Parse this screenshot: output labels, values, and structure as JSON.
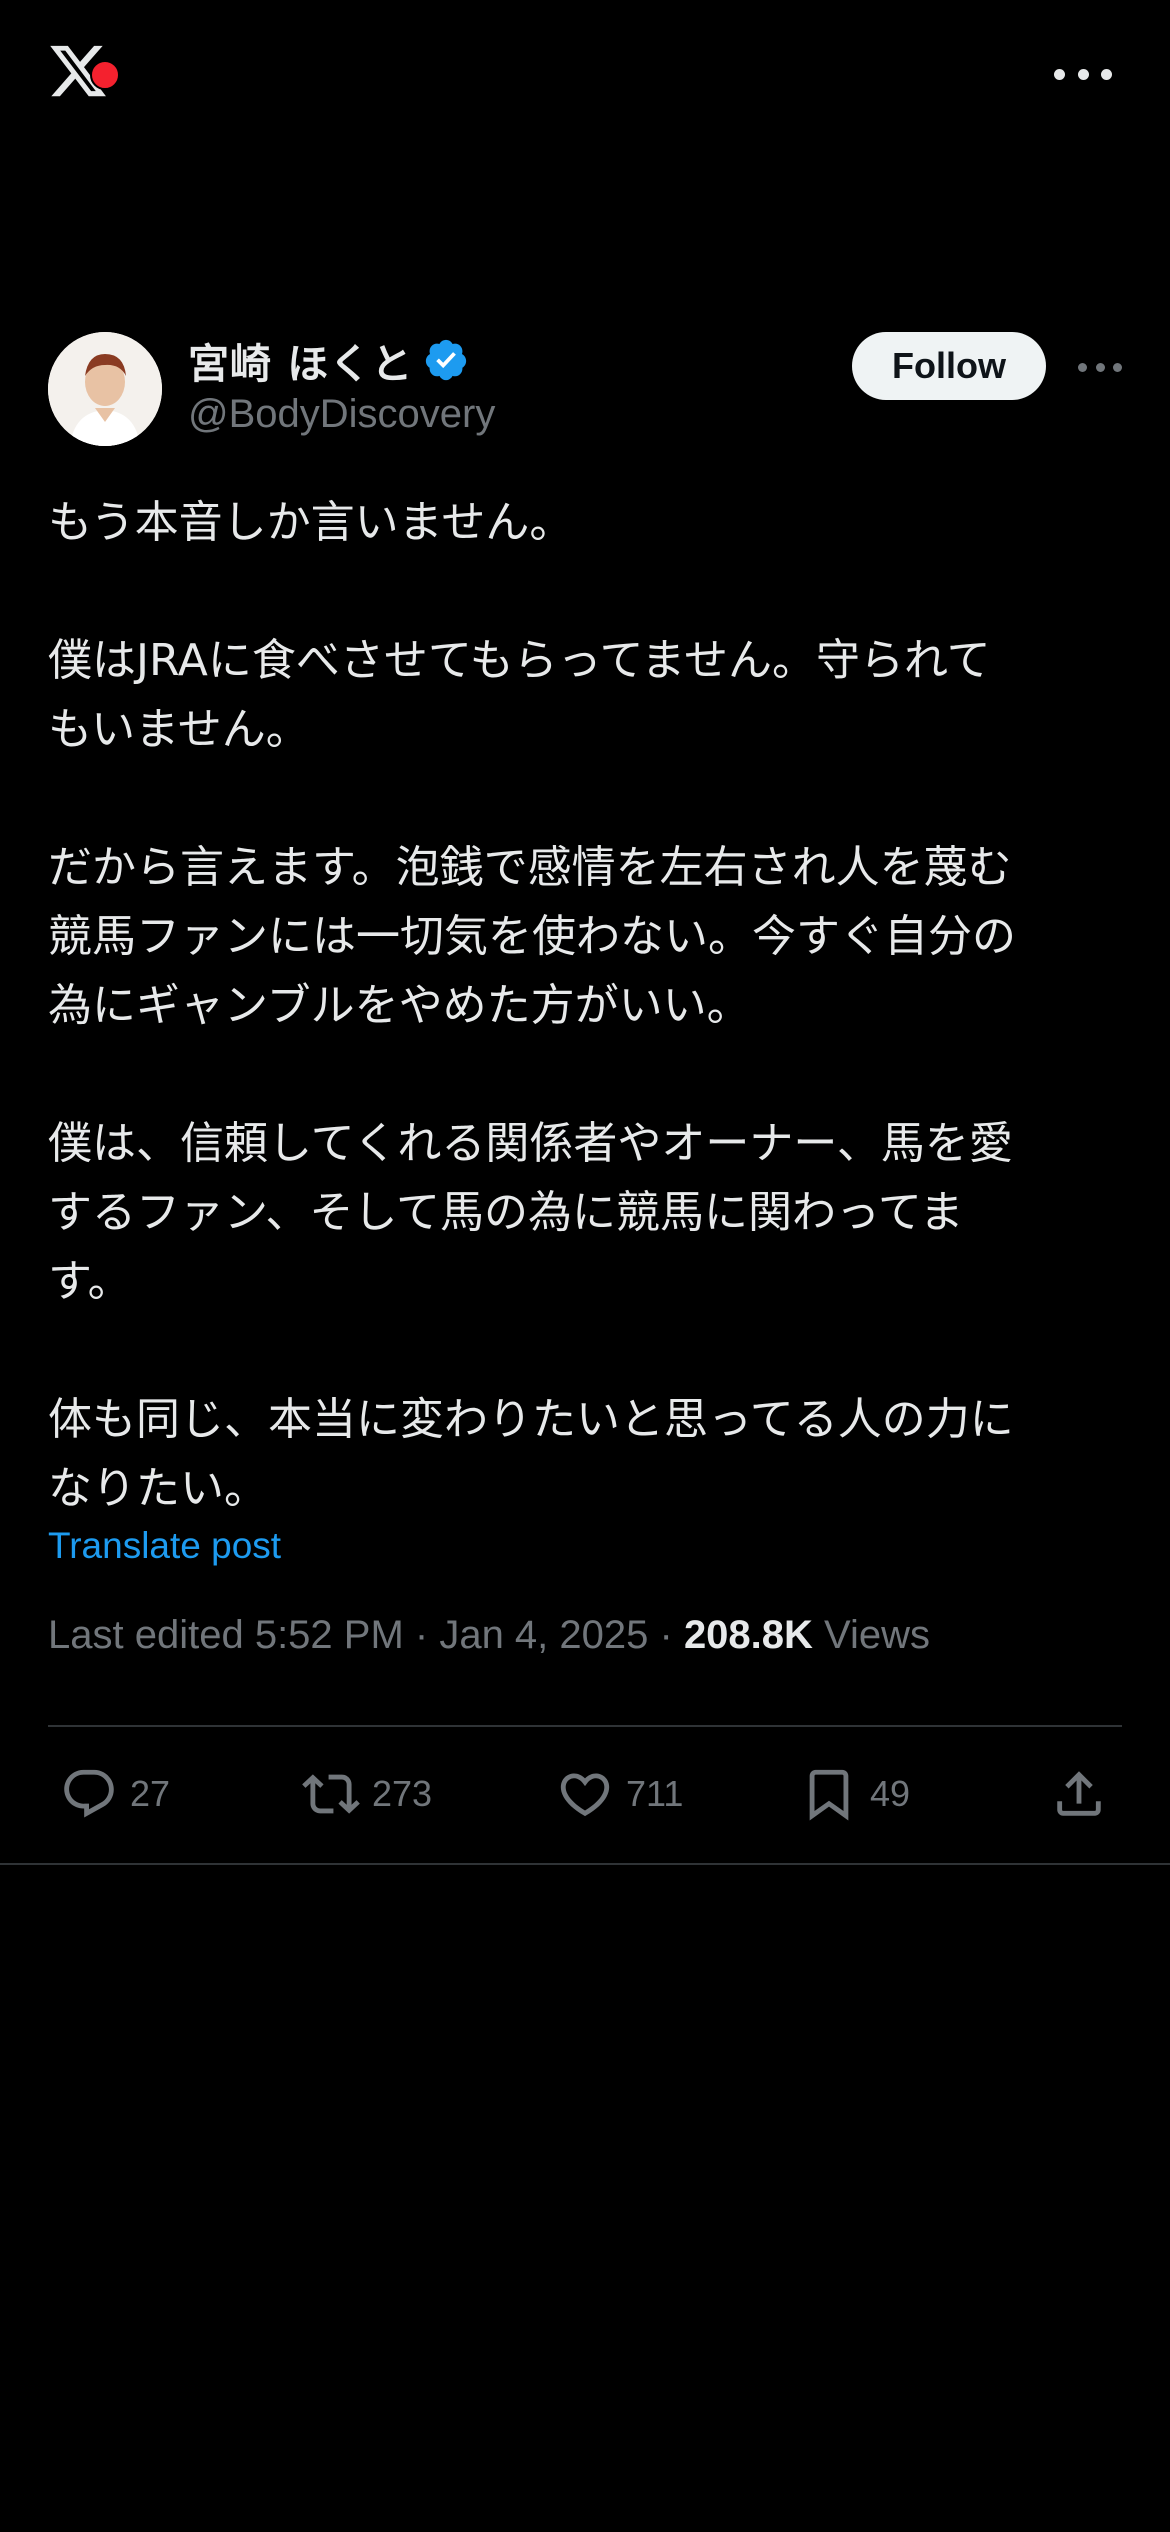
{
  "header": {
    "logo_icon": "x-logo-icon",
    "menu_icon": "more-horizontal-icon"
  },
  "author": {
    "display_name": "宮崎 ほくと",
    "handle": "@BodyDiscovery",
    "verified": true,
    "verified_color": "#1d9bf0"
  },
  "follow_label": "Follow",
  "tweet": {
    "paragraphs": [
      "もう本音しか言いません。",
      "僕はJRAに食べさせてもらってません。守られて\nもいません。",
      "だから言えます。泡銭で感情を左右され人を蔑む\n競馬ファンには一切気を使わない。今すぐ自分の\n為にギャンブルをやめた方がいい。",
      "僕は、信頼してくれる関係者やオーナー、馬を愛\nするファン、そして馬の為に競馬に関わってま\nす。",
      "体も同じ、本当に変わりたいと思ってる人の力に\nなりたい。"
    ],
    "translate_label": "Translate post"
  },
  "meta": {
    "edited_label": "Last edited 5:52 PM · Jan 4, 2025 · ",
    "views_count": "208.8K",
    "views_label": "Views"
  },
  "actions": {
    "replies": "27",
    "reposts": "273",
    "likes": "711",
    "bookmarks": "49"
  },
  "colors": {
    "background": "#000000",
    "text": "#e7e9ea",
    "secondary": "#71767b",
    "link": "#1d9bf0",
    "divider": "#2f3336"
  }
}
